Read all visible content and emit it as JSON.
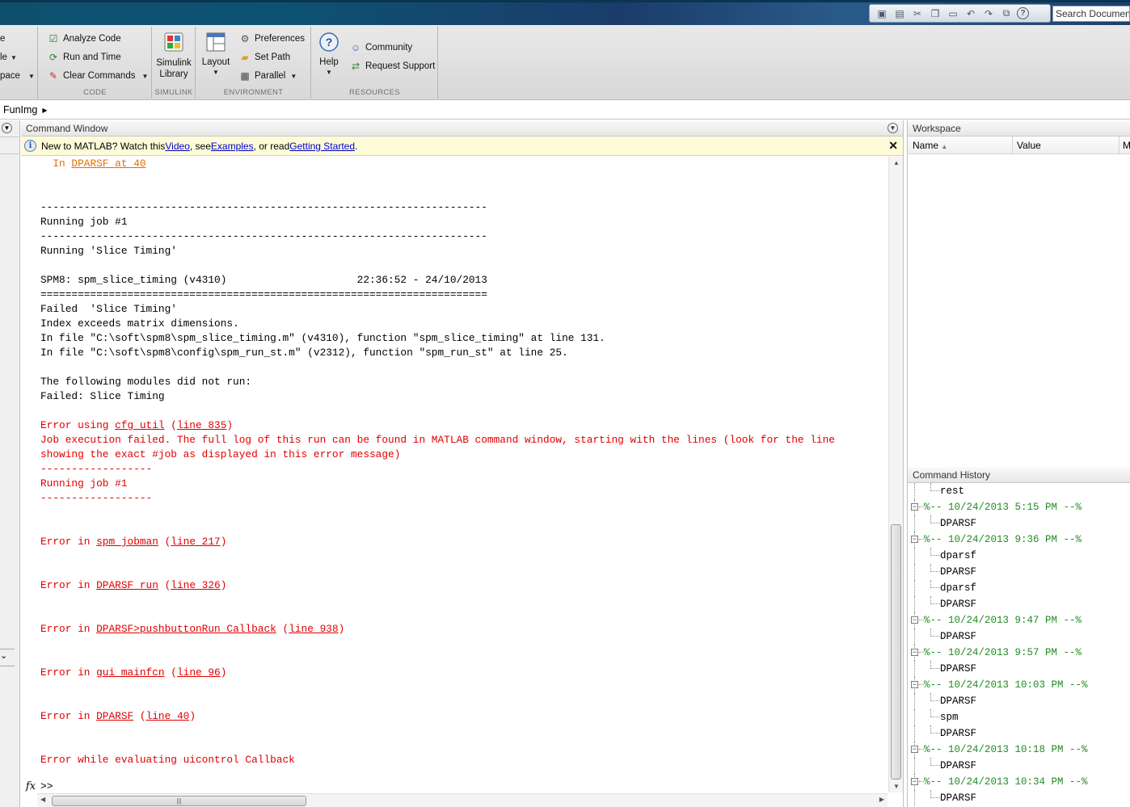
{
  "quick_access": {
    "icons": [
      "new-icon",
      "save-icon",
      "cut-icon",
      "copy-icon",
      "paste-icon",
      "undo-icon",
      "redo-icon",
      "switch-window-icon",
      "help-icon"
    ],
    "search_placeholder": "Search Documentation"
  },
  "ribbon": {
    "partial_left": {
      "item1": "e",
      "item2": "le",
      "item3": "pace"
    },
    "code": {
      "label": "CODE",
      "analyze": "Analyze Code",
      "run_time": "Run and Time",
      "clear_commands": "Clear Commands"
    },
    "simulink": {
      "label": "SIMULINK",
      "library": "Simulink\nLibrary"
    },
    "environment": {
      "label": "ENVIRONMENT",
      "layout": "Layout",
      "preferences": "Preferences",
      "set_path": "Set Path",
      "parallel": "Parallel"
    },
    "resources": {
      "label": "RESOURCES",
      "help": "Help",
      "community": "Community",
      "request_support": "Request Support"
    }
  },
  "address": {
    "path": "FunImg"
  },
  "command_window": {
    "title": "Command Window",
    "info": {
      "prefix": "New to MATLAB? Watch this ",
      "video": "Video",
      "mid1": ", see ",
      "examples": "Examples",
      "mid2": ", or read ",
      "getting_started": "Getting Started",
      "suffix": "."
    },
    "prompt": ">>"
  },
  "console_lines": [
    {
      "type": "warn_link",
      "pre": "  In ",
      "link": "DPARSF at 40",
      "post": ""
    },
    {
      "type": "blank"
    },
    {
      "type": "blank"
    },
    {
      "type": "normal",
      "text": "------------------------------------------------------------------------"
    },
    {
      "type": "normal",
      "text": "Running job #1"
    },
    {
      "type": "normal",
      "text": "------------------------------------------------------------------------"
    },
    {
      "type": "normal",
      "text": "Running 'Slice Timing'"
    },
    {
      "type": "blank"
    },
    {
      "type": "normal",
      "text": "SPM8: spm_slice_timing (v4310)                     22:36:52 - 24/10/2013"
    },
    {
      "type": "normal",
      "text": "========================================================================"
    },
    {
      "type": "normal",
      "text": "Failed  'Slice Timing'"
    },
    {
      "type": "normal",
      "text": "Index exceeds matrix dimensions."
    },
    {
      "type": "normal",
      "text": "In file \"C:\\soft\\spm8\\spm_slice_timing.m\" (v4310), function \"spm_slice_timing\" at line 131."
    },
    {
      "type": "normal",
      "text": "In file \"C:\\soft\\spm8\\config\\spm_run_st.m\" (v2312), function \"spm_run_st\" at line 25."
    },
    {
      "type": "blank"
    },
    {
      "type": "normal",
      "text": "The following modules did not run:"
    },
    {
      "type": "normal",
      "text": "Failed: Slice Timing"
    },
    {
      "type": "blank"
    },
    {
      "type": "err_links",
      "pre": "Error using ",
      "link": "cfg_util",
      "mid": " (",
      "link2": "line 835",
      "post": ")"
    },
    {
      "type": "err",
      "text": "Job execution failed. The full log of this run can be found in MATLAB command window, starting with the lines (look for the line"
    },
    {
      "type": "err",
      "text": "showing the exact #job as displayed in this error message)"
    },
    {
      "type": "err",
      "text": "------------------"
    },
    {
      "type": "err",
      "text": "Running job #1"
    },
    {
      "type": "err",
      "text": "------------------"
    },
    {
      "type": "blank"
    },
    {
      "type": "blank"
    },
    {
      "type": "err_links",
      "pre": "Error in ",
      "link": "spm_jobman",
      "mid": " (",
      "link2": "line 217",
      "post": ")"
    },
    {
      "type": "blank"
    },
    {
      "type": "blank"
    },
    {
      "type": "err_links",
      "pre": "Error in ",
      "link": "DPARSF_run",
      "mid": " (",
      "link2": "line 326",
      "post": ")"
    },
    {
      "type": "blank"
    },
    {
      "type": "blank"
    },
    {
      "type": "err_links",
      "pre": "Error in ",
      "link": "DPARSF>pushbuttonRun_Callback",
      "mid": " (",
      "link2": "line 938",
      "post": ")"
    },
    {
      "type": "blank"
    },
    {
      "type": "blank"
    },
    {
      "type": "err_links",
      "pre": "Error in ",
      "link": "gui_mainfcn",
      "mid": " (",
      "link2": "line 96",
      "post": ")"
    },
    {
      "type": "blank"
    },
    {
      "type": "blank"
    },
    {
      "type": "err_links",
      "pre": "Error in ",
      "link": "DPARSF",
      "mid": " (",
      "link2": "line 40",
      "post": ")"
    },
    {
      "type": "blank"
    },
    {
      "type": "blank"
    },
    {
      "type": "err",
      "text": "Error while evaluating uicontrol Callback"
    }
  ],
  "workspace": {
    "title": "Workspace",
    "columns": [
      "Name",
      "Value",
      "M"
    ]
  },
  "history": {
    "title": "Command History",
    "rows": [
      {
        "kind": "cmd",
        "text": "rest"
      },
      {
        "kind": "session",
        "text": "%-- 10/24/2013 5:15 PM --%"
      },
      {
        "kind": "cmd",
        "text": "DPARSF"
      },
      {
        "kind": "session",
        "text": "%-- 10/24/2013 9:36 PM --%"
      },
      {
        "kind": "cmd",
        "text": "dparsf"
      },
      {
        "kind": "cmd",
        "text": "DPARSF"
      },
      {
        "kind": "cmd",
        "text": "dparsf"
      },
      {
        "kind": "cmd",
        "text": "DPARSF"
      },
      {
        "kind": "session",
        "text": "%-- 10/24/2013 9:47 PM --%"
      },
      {
        "kind": "cmd",
        "text": "DPARSF"
      },
      {
        "kind": "session",
        "text": "%-- 10/24/2013 9:57 PM --%"
      },
      {
        "kind": "cmd",
        "text": "DPARSF"
      },
      {
        "kind": "session",
        "text": "%-- 10/24/2013 10:03 PM --%"
      },
      {
        "kind": "cmd",
        "text": "DPARSF"
      },
      {
        "kind": "cmd",
        "text": "spm"
      },
      {
        "kind": "cmd",
        "text": "DPARSF"
      },
      {
        "kind": "session",
        "text": "%-- 10/24/2013 10:18 PM --%"
      },
      {
        "kind": "cmd",
        "text": "DPARSF"
      },
      {
        "kind": "session",
        "text": "%-- 10/24/2013 10:34 PM --%"
      },
      {
        "kind": "cmd",
        "text": "DPARSF"
      }
    ]
  }
}
